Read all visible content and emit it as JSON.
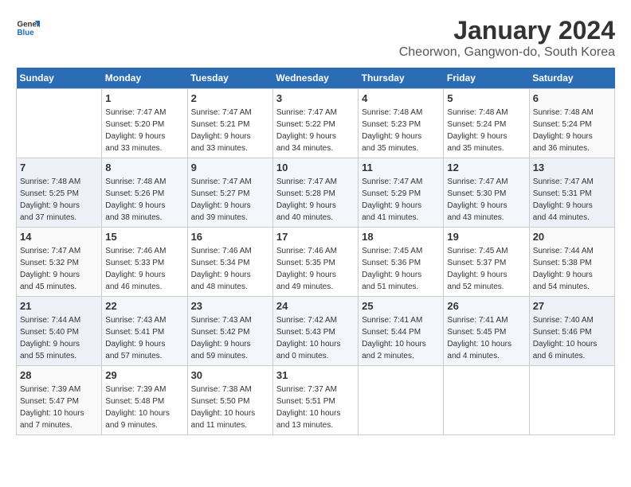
{
  "logo": {
    "line1": "General",
    "line2": "Blue"
  },
  "title": "January 2024",
  "subtitle": "Cheorwon, Gangwon-do, South Korea",
  "days_header": [
    "Sunday",
    "Monday",
    "Tuesday",
    "Wednesday",
    "Thursday",
    "Friday",
    "Saturday"
  ],
  "weeks": [
    [
      {
        "day": "",
        "info": ""
      },
      {
        "day": "1",
        "info": "Sunrise: 7:47 AM\nSunset: 5:20 PM\nDaylight: 9 hours\nand 33 minutes."
      },
      {
        "day": "2",
        "info": "Sunrise: 7:47 AM\nSunset: 5:21 PM\nDaylight: 9 hours\nand 33 minutes."
      },
      {
        "day": "3",
        "info": "Sunrise: 7:47 AM\nSunset: 5:22 PM\nDaylight: 9 hours\nand 34 minutes."
      },
      {
        "day": "4",
        "info": "Sunrise: 7:48 AM\nSunset: 5:23 PM\nDaylight: 9 hours\nand 35 minutes."
      },
      {
        "day": "5",
        "info": "Sunrise: 7:48 AM\nSunset: 5:24 PM\nDaylight: 9 hours\nand 35 minutes."
      },
      {
        "day": "6",
        "info": "Sunrise: 7:48 AM\nSunset: 5:24 PM\nDaylight: 9 hours\nand 36 minutes."
      }
    ],
    [
      {
        "day": "7",
        "info": "Sunrise: 7:48 AM\nSunset: 5:25 PM\nDaylight: 9 hours\nand 37 minutes."
      },
      {
        "day": "8",
        "info": "Sunrise: 7:48 AM\nSunset: 5:26 PM\nDaylight: 9 hours\nand 38 minutes."
      },
      {
        "day": "9",
        "info": "Sunrise: 7:47 AM\nSunset: 5:27 PM\nDaylight: 9 hours\nand 39 minutes."
      },
      {
        "day": "10",
        "info": "Sunrise: 7:47 AM\nSunset: 5:28 PM\nDaylight: 9 hours\nand 40 minutes."
      },
      {
        "day": "11",
        "info": "Sunrise: 7:47 AM\nSunset: 5:29 PM\nDaylight: 9 hours\nand 41 minutes."
      },
      {
        "day": "12",
        "info": "Sunrise: 7:47 AM\nSunset: 5:30 PM\nDaylight: 9 hours\nand 43 minutes."
      },
      {
        "day": "13",
        "info": "Sunrise: 7:47 AM\nSunset: 5:31 PM\nDaylight: 9 hours\nand 44 minutes."
      }
    ],
    [
      {
        "day": "14",
        "info": "Sunrise: 7:47 AM\nSunset: 5:32 PM\nDaylight: 9 hours\nand 45 minutes."
      },
      {
        "day": "15",
        "info": "Sunrise: 7:46 AM\nSunset: 5:33 PM\nDaylight: 9 hours\nand 46 minutes."
      },
      {
        "day": "16",
        "info": "Sunrise: 7:46 AM\nSunset: 5:34 PM\nDaylight: 9 hours\nand 48 minutes."
      },
      {
        "day": "17",
        "info": "Sunrise: 7:46 AM\nSunset: 5:35 PM\nDaylight: 9 hours\nand 49 minutes."
      },
      {
        "day": "18",
        "info": "Sunrise: 7:45 AM\nSunset: 5:36 PM\nDaylight: 9 hours\nand 51 minutes."
      },
      {
        "day": "19",
        "info": "Sunrise: 7:45 AM\nSunset: 5:37 PM\nDaylight: 9 hours\nand 52 minutes."
      },
      {
        "day": "20",
        "info": "Sunrise: 7:44 AM\nSunset: 5:38 PM\nDaylight: 9 hours\nand 54 minutes."
      }
    ],
    [
      {
        "day": "21",
        "info": "Sunrise: 7:44 AM\nSunset: 5:40 PM\nDaylight: 9 hours\nand 55 minutes."
      },
      {
        "day": "22",
        "info": "Sunrise: 7:43 AM\nSunset: 5:41 PM\nDaylight: 9 hours\nand 57 minutes."
      },
      {
        "day": "23",
        "info": "Sunrise: 7:43 AM\nSunset: 5:42 PM\nDaylight: 9 hours\nand 59 minutes."
      },
      {
        "day": "24",
        "info": "Sunrise: 7:42 AM\nSunset: 5:43 PM\nDaylight: 10 hours\nand 0 minutes."
      },
      {
        "day": "25",
        "info": "Sunrise: 7:41 AM\nSunset: 5:44 PM\nDaylight: 10 hours\nand 2 minutes."
      },
      {
        "day": "26",
        "info": "Sunrise: 7:41 AM\nSunset: 5:45 PM\nDaylight: 10 hours\nand 4 minutes."
      },
      {
        "day": "27",
        "info": "Sunrise: 7:40 AM\nSunset: 5:46 PM\nDaylight: 10 hours\nand 6 minutes."
      }
    ],
    [
      {
        "day": "28",
        "info": "Sunrise: 7:39 AM\nSunset: 5:47 PM\nDaylight: 10 hours\nand 7 minutes."
      },
      {
        "day": "29",
        "info": "Sunrise: 7:39 AM\nSunset: 5:48 PM\nDaylight: 10 hours\nand 9 minutes."
      },
      {
        "day": "30",
        "info": "Sunrise: 7:38 AM\nSunset: 5:50 PM\nDaylight: 10 hours\nand 11 minutes."
      },
      {
        "day": "31",
        "info": "Sunrise: 7:37 AM\nSunset: 5:51 PM\nDaylight: 10 hours\nand 13 minutes."
      },
      {
        "day": "",
        "info": ""
      },
      {
        "day": "",
        "info": ""
      },
      {
        "day": "",
        "info": ""
      }
    ]
  ]
}
